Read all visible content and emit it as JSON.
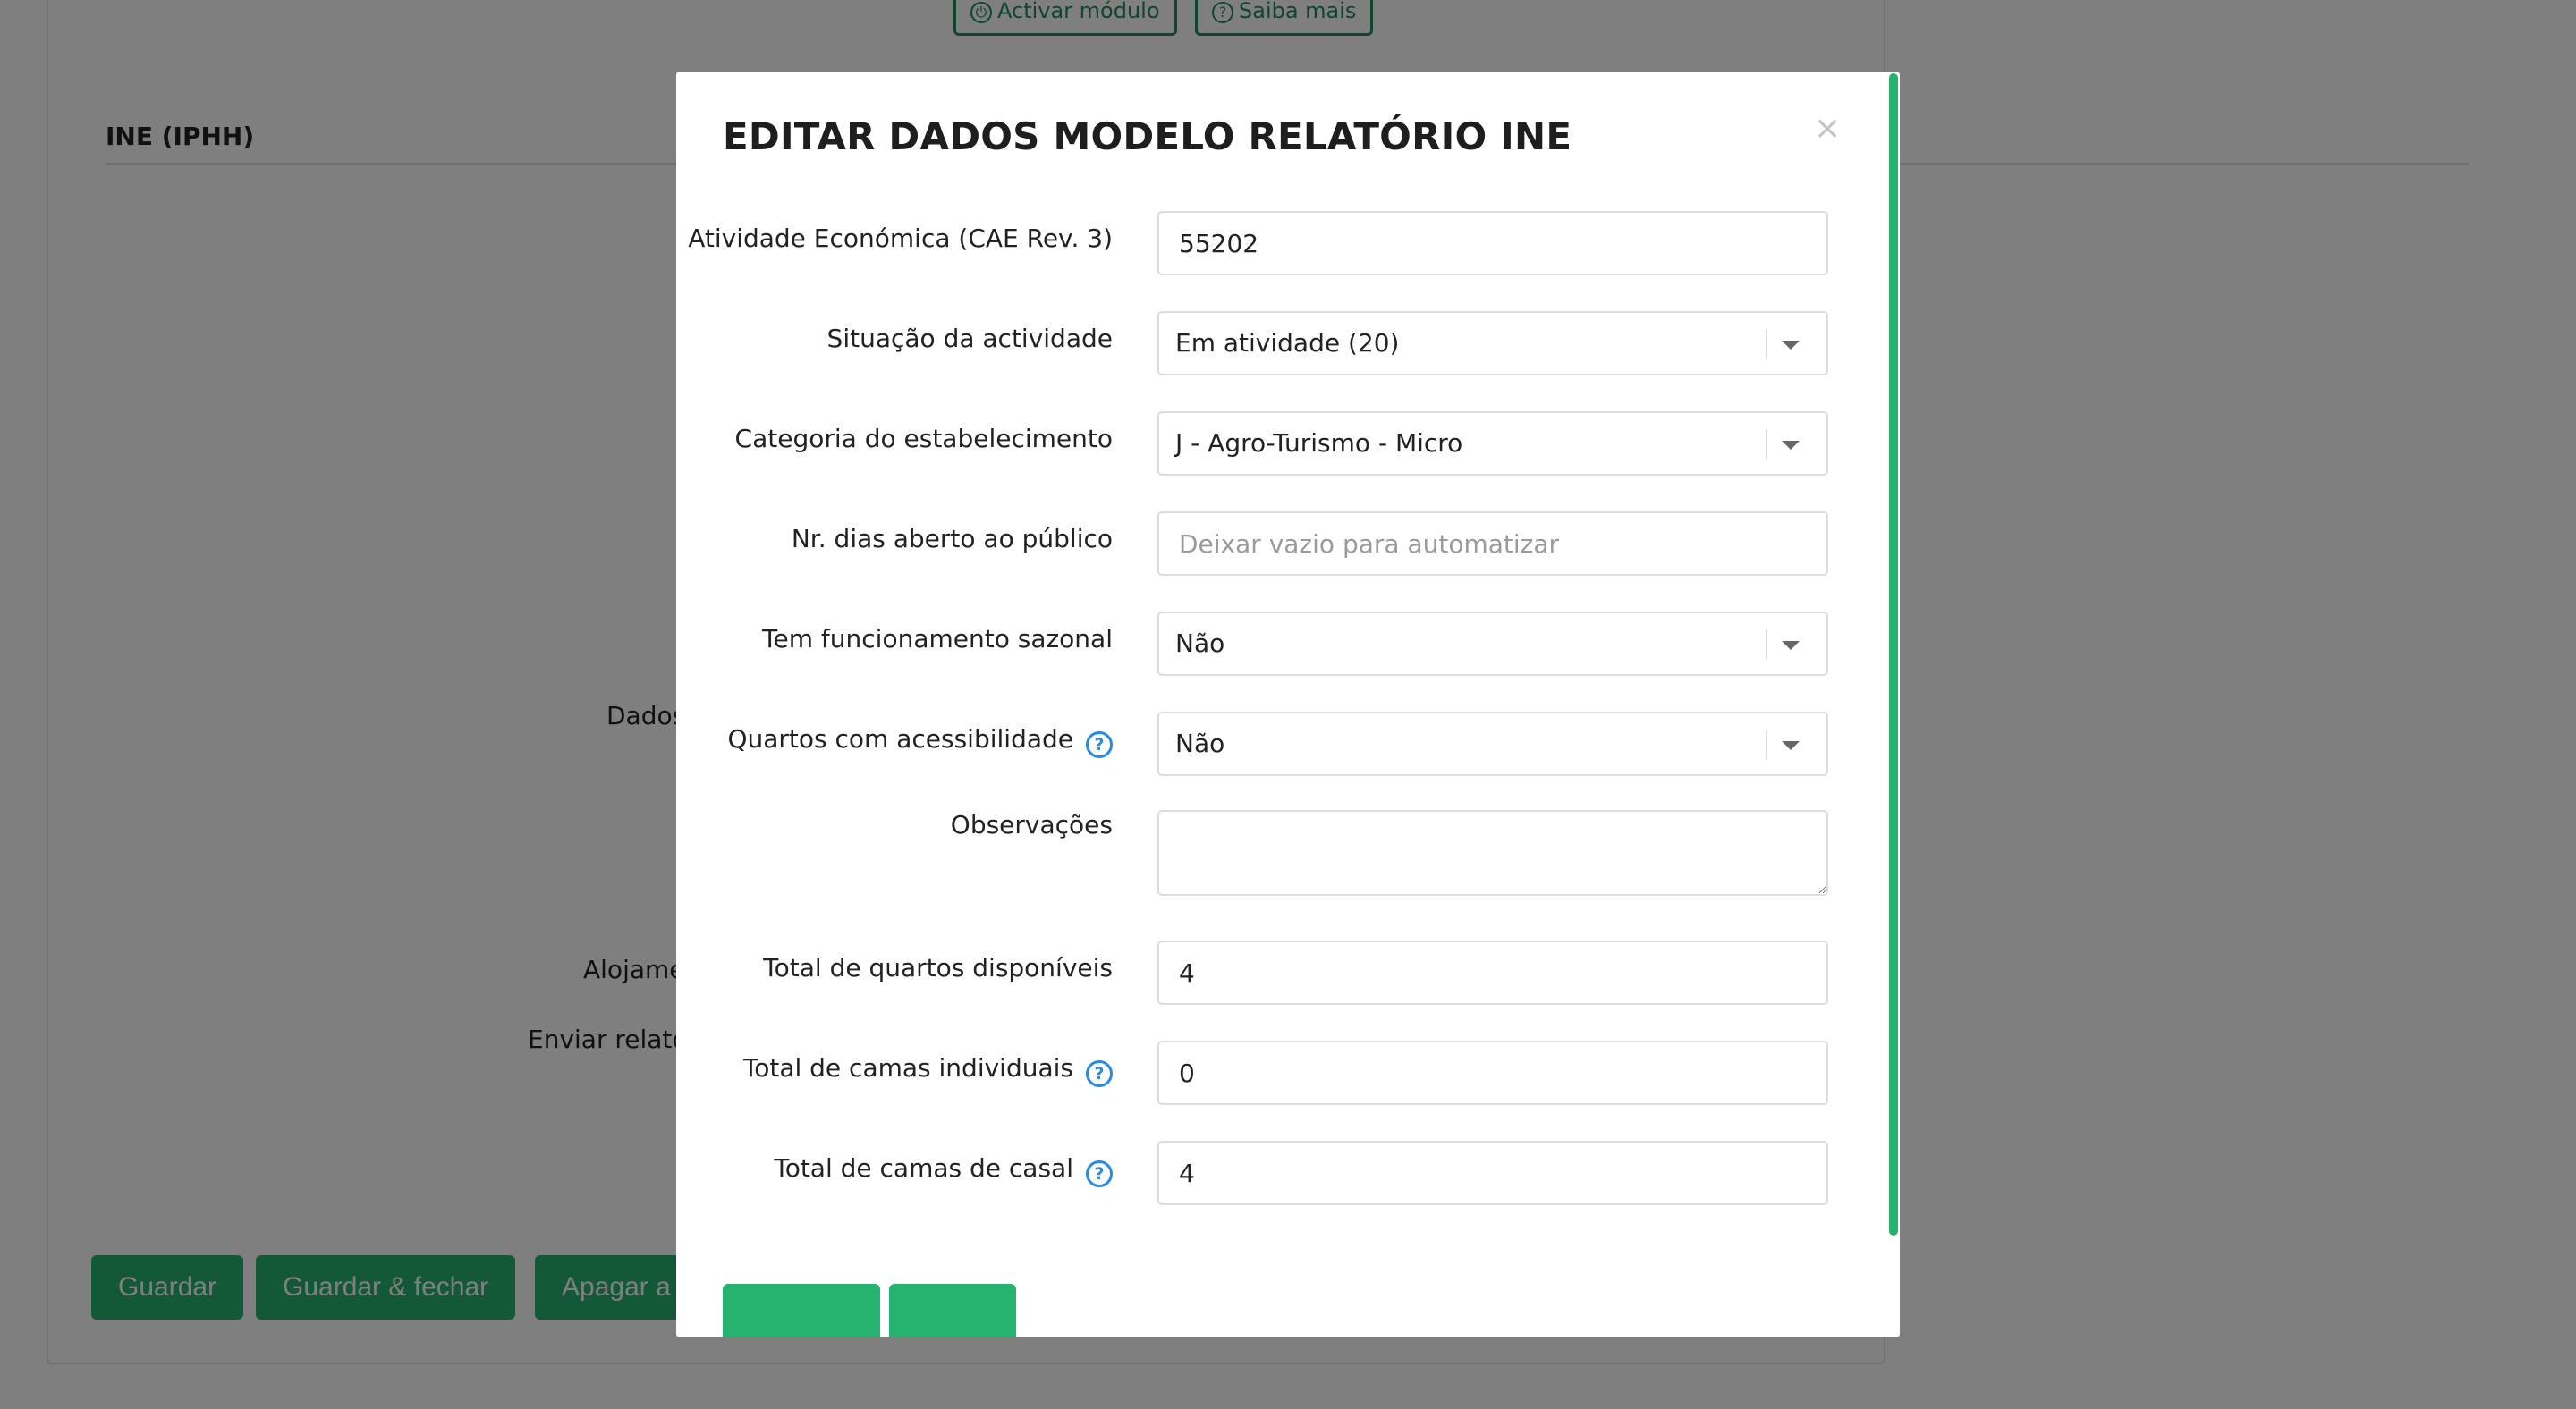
{
  "background": {
    "top_buttons": [
      {
        "label": "Activar módulo",
        "icon": "power-icon"
      },
      {
        "label": "Saiba mais",
        "icon": "help-icon"
      }
    ],
    "section_title": "INE (IPHH)",
    "side_labels": {
      "dados": "Dados",
      "alojamento": "Alojame",
      "enviar": "Enviar relatór"
    },
    "buttons": {
      "save": "Guardar",
      "save_close": "Guardar & fechar",
      "delete": "Apagar a"
    }
  },
  "modal": {
    "title": "EDITAR DADOS MODELO RELATÓRIO INE",
    "close": "×",
    "fields": {
      "cae": {
        "label": "Atividade Económica (CAE Rev. 3)",
        "value": "55202"
      },
      "situacao": {
        "label": "Situação da actividade",
        "value": "Em atividade (20)"
      },
      "categoria": {
        "label": "Categoria do estabelecimento",
        "value": "J - Agro-Turismo - Micro"
      },
      "dias_aberto": {
        "label": "Nr. dias aberto ao público",
        "value": "",
        "placeholder": "Deixar vazio para automatizar"
      },
      "sazonal": {
        "label": "Tem funcionamento sazonal",
        "value": "Não"
      },
      "acessibilidade": {
        "label": "Quartos com acessibilidade",
        "value": "Não"
      },
      "observacoes": {
        "label": "Observações",
        "value": ""
      },
      "total_quartos": {
        "label": "Total de quartos disponíveis",
        "value": "4"
      },
      "camas_individuais": {
        "label": "Total de camas individuais",
        "value": "0"
      },
      "camas_casal": {
        "label": "Total de camas de casal",
        "value": "4"
      }
    }
  },
  "colors": {
    "accent_green": "#26b36f",
    "help_blue": "#2a8be0",
    "overlay": "rgba(0,0,0,0.5)"
  }
}
